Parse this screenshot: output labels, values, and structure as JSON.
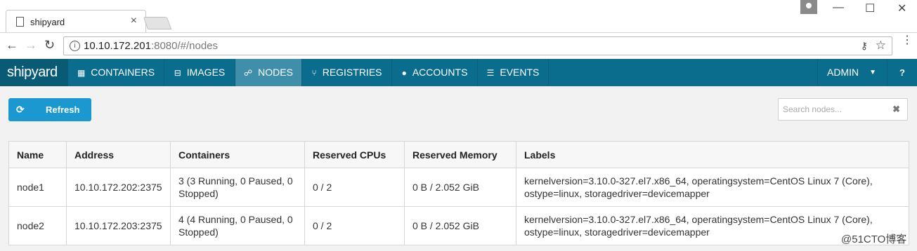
{
  "browser": {
    "tab_title": "shipyard",
    "tab_close": "×",
    "url_host": "10.10.172.201",
    "url_rest": ":8080/#/nodes",
    "back": "←",
    "forward": "→",
    "reload": "↻",
    "minimize": "—",
    "maximize": "☐",
    "close": "✕",
    "info": "i",
    "star": "☆",
    "key": "⚷",
    "menu": "⋮"
  },
  "navbar": {
    "brand": "shipyard",
    "items": [
      {
        "label": "CONTAINERS",
        "icon": "th-icon",
        "glyph": "▦",
        "active": false
      },
      {
        "label": "IMAGES",
        "icon": "hdd-icon",
        "glyph": "⊟",
        "active": false
      },
      {
        "label": "NODES",
        "icon": "sitemap-icon",
        "glyph": "☍",
        "active": true
      },
      {
        "label": "REGISTRIES",
        "icon": "code-fork-icon",
        "glyph": "⑂",
        "active": false
      },
      {
        "label": "ACCOUNTS",
        "icon": "user-icon",
        "glyph": "●",
        "active": false
      },
      {
        "label": "EVENTS",
        "icon": "list-icon",
        "glyph": "☰",
        "active": false
      }
    ],
    "admin": "ADMIN",
    "admin_caret": "▼",
    "help": "?"
  },
  "toolbar": {
    "refresh_label": "Refresh",
    "refresh_icon": "⟳",
    "search_placeholder": "Search nodes...",
    "clear_icon": "✖"
  },
  "table": {
    "columns": [
      "Name",
      "Address",
      "Containers",
      "Reserved CPUs",
      "Reserved Memory",
      "Labels"
    ],
    "rows": [
      {
        "name": "node1",
        "address": "10.10.172.202:2375",
        "containers": "3 (3 Running, 0 Paused, 0 Stopped)",
        "cpus": "0 / 2",
        "memory": "0 B / 2.052 GiB",
        "labels": "kernelversion=3.10.0-327.el7.x86_64, operatingsystem=CentOS Linux 7 (Core), ostype=linux, storagedriver=devicemapper"
      },
      {
        "name": "node2",
        "address": "10.10.172.203:2375",
        "containers": "4 (4 Running, 0 Paused, 0 Stopped)",
        "cpus": "0 / 2",
        "memory": "0 B / 2.052 GiB",
        "labels": "kernelversion=3.10.0-327.el7.x86_64, operatingsystem=CentOS Linux 7 (Core), ostype=linux, storagedriver=devicemapper"
      }
    ]
  },
  "watermark": "@51CTO博客",
  "colors": {
    "navbar": "#0a6d8e",
    "brand_bg": "#095a75",
    "active_tab": "#3f8fab",
    "button": "#1a98cf"
  }
}
